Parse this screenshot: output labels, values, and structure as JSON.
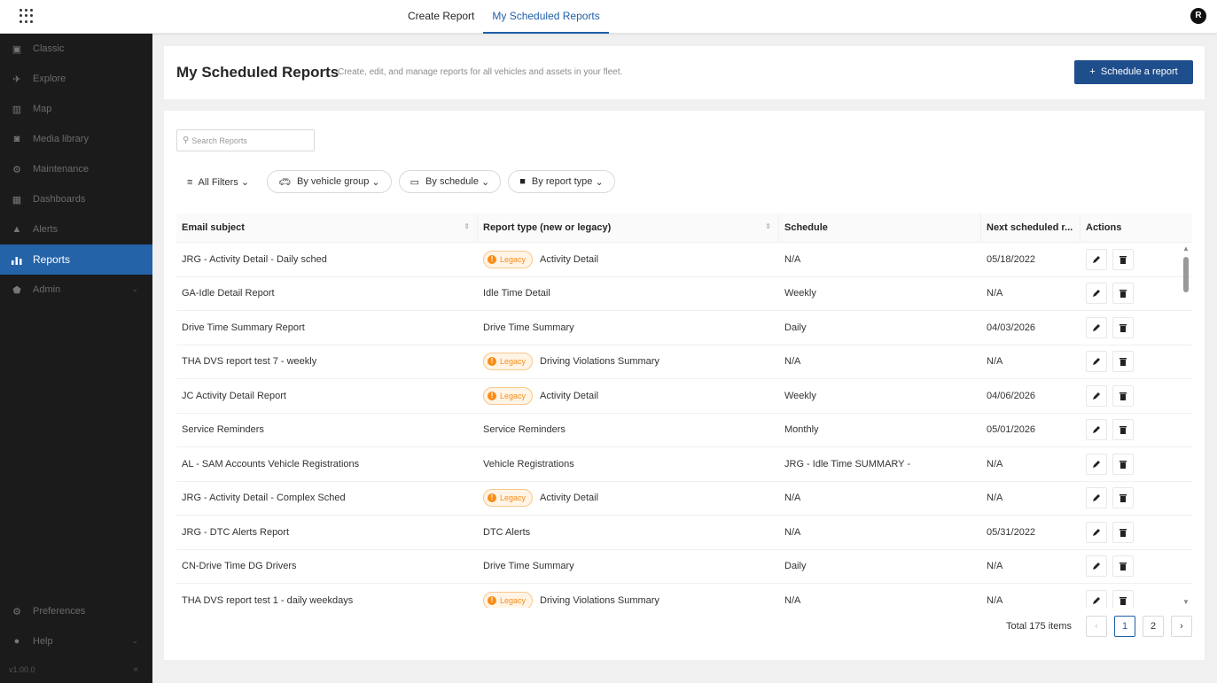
{
  "topbar": {
    "tabs": [
      {
        "label": "Create Report",
        "active": false
      },
      {
        "label": "My Scheduled Reports",
        "active": true
      }
    ],
    "avatar_initial": "R"
  },
  "sidebar": {
    "items": [
      {
        "label": "Classic",
        "icon": "classic-icon"
      },
      {
        "label": "Explore",
        "icon": "explore-icon"
      },
      {
        "label": "Map",
        "icon": "map-icon"
      },
      {
        "label": "Media library",
        "icon": "camera-icon"
      },
      {
        "label": "Maintenance",
        "icon": "maintenance-icon"
      },
      {
        "label": "Dashboards",
        "icon": "dashboard-icon"
      },
      {
        "label": "Alerts",
        "icon": "bell-icon"
      },
      {
        "label": "Reports",
        "icon": "bar-chart-icon",
        "active": true
      },
      {
        "label": "Admin",
        "icon": "shield-icon"
      }
    ],
    "bottom": [
      {
        "label": "Preferences",
        "icon": "gear-icon"
      },
      {
        "label": "Help",
        "icon": "help-icon"
      }
    ],
    "version": "v1.00.0"
  },
  "header": {
    "title": "My Scheduled Reports",
    "subtitle": "Create, edit, and manage reports for all vehicles and assets in your fleet.",
    "schedule_button": "Schedule a report"
  },
  "search": {
    "placeholder": "Search Reports"
  },
  "filters": {
    "all": "All Filters",
    "pills": [
      "By vehicle group",
      "By schedule",
      "By report type"
    ]
  },
  "table": {
    "columns": [
      "Email subject",
      "Report type (new or legacy)",
      "Schedule",
      "Next scheduled r...",
      "Actions"
    ],
    "legacy_label": "Legacy",
    "rows": [
      {
        "subject": "JRG - Activity Detail - Daily sched",
        "legacy": true,
        "type": "Activity Detail",
        "schedule": "N/A",
        "next": "05/18/2022"
      },
      {
        "subject": "GA-Idle Detail Report",
        "legacy": false,
        "type": "Idle Time Detail",
        "schedule": "Weekly",
        "next": "N/A"
      },
      {
        "subject": "Drive Time Summary Report",
        "legacy": false,
        "type": "Drive Time Summary",
        "schedule": "Daily",
        "next": "04/03/2026"
      },
      {
        "subject": "THA DVS report test 7 - weekly",
        "legacy": true,
        "type": "Driving Violations Summary",
        "schedule": "N/A",
        "next": "N/A"
      },
      {
        "subject": "JC Activity Detail Report",
        "legacy": true,
        "type": "Activity Detail",
        "schedule": "Weekly",
        "next": "04/06/2026"
      },
      {
        "subject": "Service Reminders",
        "legacy": false,
        "type": "Service Reminders",
        "schedule": "Monthly",
        "next": "05/01/2026"
      },
      {
        "subject": "AL - SAM Accounts Vehicle Registrations",
        "legacy": false,
        "type": "Vehicle Registrations",
        "schedule": "JRG - Idle Time SUMMARY -",
        "next": "N/A"
      },
      {
        "subject": "JRG - Activity Detail - Complex Sched",
        "legacy": true,
        "type": "Activity Detail",
        "schedule": "N/A",
        "next": "N/A"
      },
      {
        "subject": "JRG - DTC Alerts Report",
        "legacy": false,
        "type": "DTC Alerts",
        "schedule": "N/A",
        "next": "05/31/2022"
      },
      {
        "subject": "CN-Drive Time DG Drivers",
        "legacy": false,
        "type": "Drive Time Summary",
        "schedule": "Daily",
        "next": "N/A"
      },
      {
        "subject": "THA DVS report test 1 - daily weekdays",
        "legacy": true,
        "type": "Driving Violations Summary",
        "schedule": "N/A",
        "next": "N/A"
      }
    ]
  },
  "pagination": {
    "total": "Total 175 items",
    "pages": [
      "1",
      "2"
    ],
    "current": "1"
  }
}
